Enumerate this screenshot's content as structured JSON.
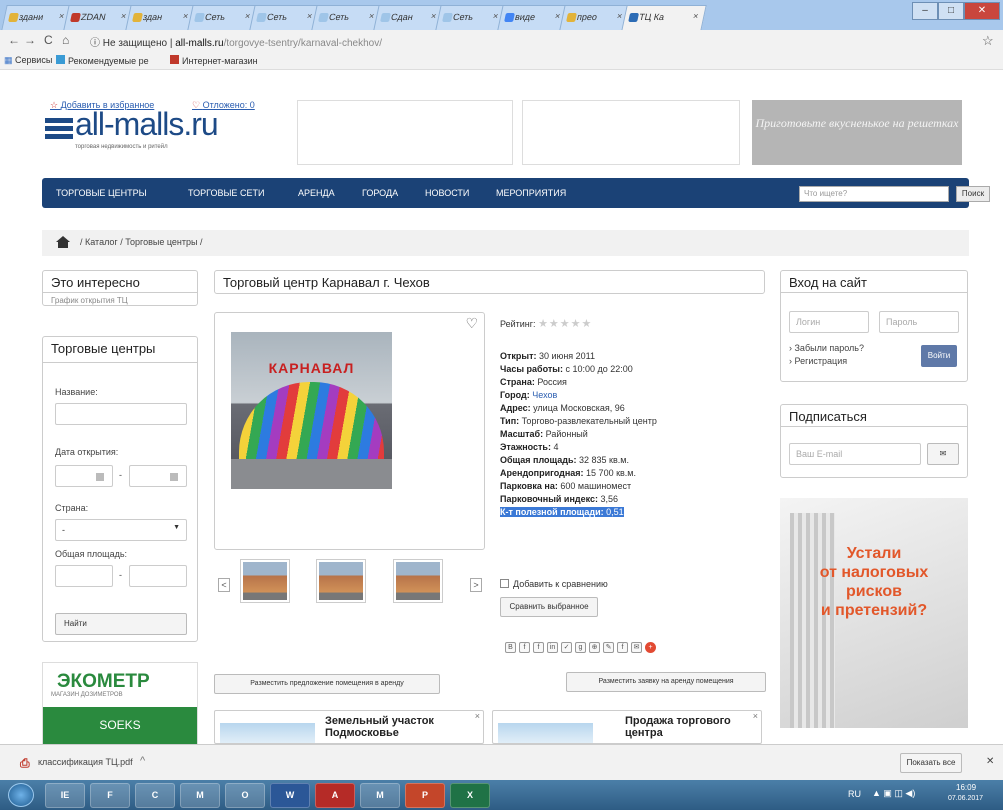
{
  "browser": {
    "tabs": [
      {
        "label": "здани",
        "color": "#e2b33a"
      },
      {
        "label": "ZDAN",
        "color": "#c0392b"
      },
      {
        "label": "здан",
        "color": "#e2b33a"
      },
      {
        "label": "Сеть",
        "color": "#9fc5e8"
      },
      {
        "label": "Сеть",
        "color": "#9fc5e8"
      },
      {
        "label": "Сеть",
        "color": "#9fc5e8"
      },
      {
        "label": "Сдан",
        "color": "#9fc5e8"
      },
      {
        "label": "Сеть",
        "color": "#9fc5e8"
      },
      {
        "label": "виде",
        "color": "#4285f4"
      },
      {
        "label": "прео",
        "color": "#e2b33a"
      },
      {
        "label": "ТЦ Ка",
        "color": "#2d6cb5"
      }
    ],
    "window_controls": [
      "–",
      "□",
      "✕"
    ],
    "back": "←",
    "forward": "→",
    "reload": "C",
    "home_btn": "⌂",
    "security": "ⓘ Не защищено",
    "address_host": "all-malls.ru",
    "address_path": "/torgovye-tsentry/karnaval-chekhov/",
    "star": "☆",
    "bookmarks": [
      "Сервисы",
      "Рекомендуемые ре",
      "Интернет-магазин"
    ]
  },
  "site": {
    "favorite_link": "Добавить в избранное",
    "compare_link": "Отложено: 0",
    "logo_text": "all-malls.ru",
    "logo_subtitle": "торговая недвижимость и ритейл",
    "promo_text": "Приготовьте вкусненькое на решетках",
    "nav": [
      "ТОРГОВЫЕ ЦЕНТРЫ",
      "ТОРГОВЫЕ СЕТИ",
      "АРЕНДА",
      "ГОРОДА",
      "НОВОСТИ",
      "МЕРОПРИЯТИЯ"
    ],
    "search_placeholder": "Что ищете?",
    "search_button": "Поиск"
  },
  "breadcrumbs": "/ Каталог / Торговые центры /",
  "sidebar_left": {
    "interesting_title": "Это интересно",
    "interesting_link": "График открытия ТЦ",
    "filter_title": "Торговые центры",
    "name_label": "Название:",
    "date_label": "Дата открытия:",
    "dash": "-",
    "country_label": "Страна:",
    "country_value": "-",
    "area_label": "Общая площадь:",
    "find_button": "Найти",
    "eco_title": "ЭКОМЕТР",
    "eco_subtitle": "МАГАЗИН ДОЗИМЕТРОВ",
    "eco_brand": "SOEKS"
  },
  "main": {
    "title": "Торговый центр Карнавал г. Чехов",
    "image_sign": "КАРНАВАЛ",
    "rating_label": "Рейтинг:",
    "rating_stars": "★★★★★",
    "rating_value": 0,
    "facts": {
      "opened_k": "Открыт:",
      "opened_v": "30 июня 2011",
      "hours_k": "Часы работы:",
      "hours_v": "с 10:00 до 22:00",
      "country_k": "Страна:",
      "country_v": "Россия",
      "city_k": "Город:",
      "city_v": "Чехов",
      "address_k": "Адрес:",
      "address_v": "улица Московская, 96",
      "type_k": "Тип:",
      "type_v": "Торгово-развлекательный центр",
      "scale_k": "Масштаб:",
      "scale_v": "Районный",
      "floors_k": "Этажность:",
      "floors_v": "4",
      "total_k": "Общая площадь:",
      "total_v": "32 835 кв.м.",
      "rent_k": "Арендопригодная:",
      "rent_v": "15 700 кв.м.",
      "parking_k": "Парковка на:",
      "parking_v": "600 машиномест",
      "pindex_k": "Парковочный индекс:",
      "pindex_v": "3,56",
      "useful_k": "К-т полезной площади:",
      "useful_v": "0,51"
    },
    "add_compare": "Добавить к сравнению",
    "compare_selected": "Сравнить выбранное",
    "thumb_prev": "<",
    "thumb_next": ">",
    "heart": "♡",
    "social_icons": [
      "В",
      "f",
      "f",
      "in",
      "✓",
      "g",
      "⊕",
      "✎",
      "f",
      "✉",
      "+"
    ],
    "offer_button": "Разместить предложение помещения в аренду",
    "request_button": "Разместить заявку на аренду помещения",
    "news1": "Земельный участок Подмосковье",
    "news2": "Продажа торгового центра",
    "close": "×"
  },
  "sidebar_right": {
    "login_title": "Вход на сайт",
    "login_placeholder": "Логин",
    "password_placeholder": "Пароль",
    "forgot": "Забыли пароль?",
    "register": "Регистрация",
    "login_button": "Войти",
    "subscribe_title": "Подписаться",
    "email_placeholder": "Ваш E-mail",
    "subscribe_button": "✉",
    "ad_text_1": "Устали",
    "ad_text_2": "от налоговых",
    "ad_text_3": "рисков",
    "ad_text_4": "и претензий?"
  },
  "download_bar": {
    "file": "классификация ТЦ.pdf",
    "caret": "^",
    "show_all": "Показать все",
    "close": "✕"
  },
  "taskbar": {
    "lang": "RU",
    "time": "16:09",
    "date": "07.06.2017",
    "apps": [
      "IE",
      "F",
      "C",
      "M",
      "O",
      "W",
      "A",
      "M",
      "P",
      "X"
    ]
  }
}
